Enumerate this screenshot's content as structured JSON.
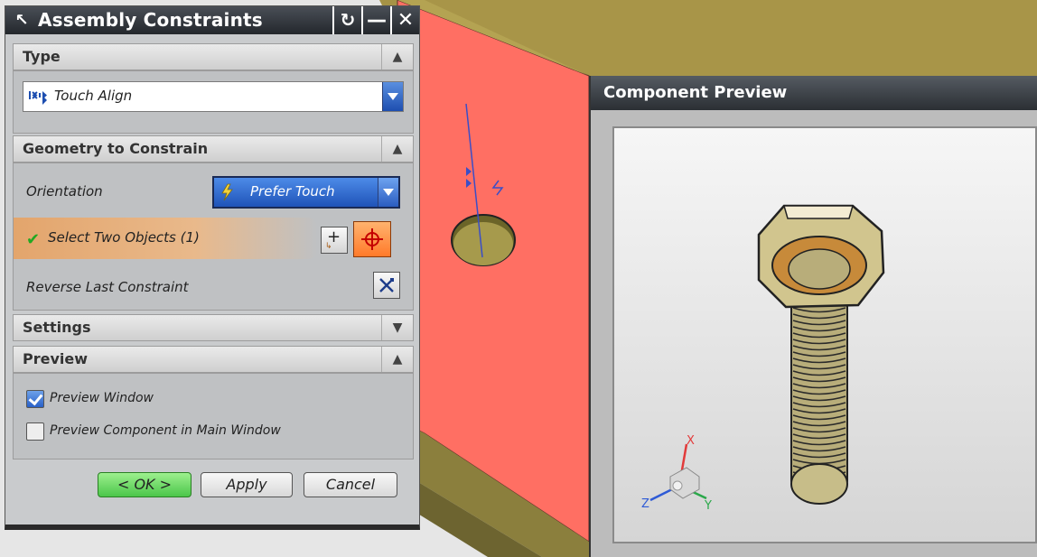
{
  "dialog": {
    "title": "Assembly Constraints",
    "sections": {
      "type": {
        "label": "Type",
        "value": "Touch Align"
      },
      "geometry": {
        "label": "Geometry to Constrain",
        "orientation_label": "Orientation",
        "orientation_value": "Prefer Touch",
        "select_label": "Select Two Objects (1)",
        "reverse_label": "Reverse Last Constraint"
      },
      "settings": {
        "label": "Settings"
      },
      "preview": {
        "label": "Preview",
        "preview_window_label": "Preview Window",
        "preview_window_checked": true,
        "preview_component_label": "Preview Component in Main Window",
        "preview_component_checked": false
      }
    },
    "buttons": {
      "ok": "< OK >",
      "apply": "Apply",
      "cancel": "Cancel"
    }
  },
  "component_preview": {
    "title": "Component Preview",
    "triad": {
      "x": "X",
      "y": "Y",
      "z": "Z"
    }
  },
  "colors": {
    "red_face": "#ff6f63",
    "olive_face": "#b4a352",
    "select_highlight": "#e3a56c",
    "accent_blue": "#2960c7"
  }
}
